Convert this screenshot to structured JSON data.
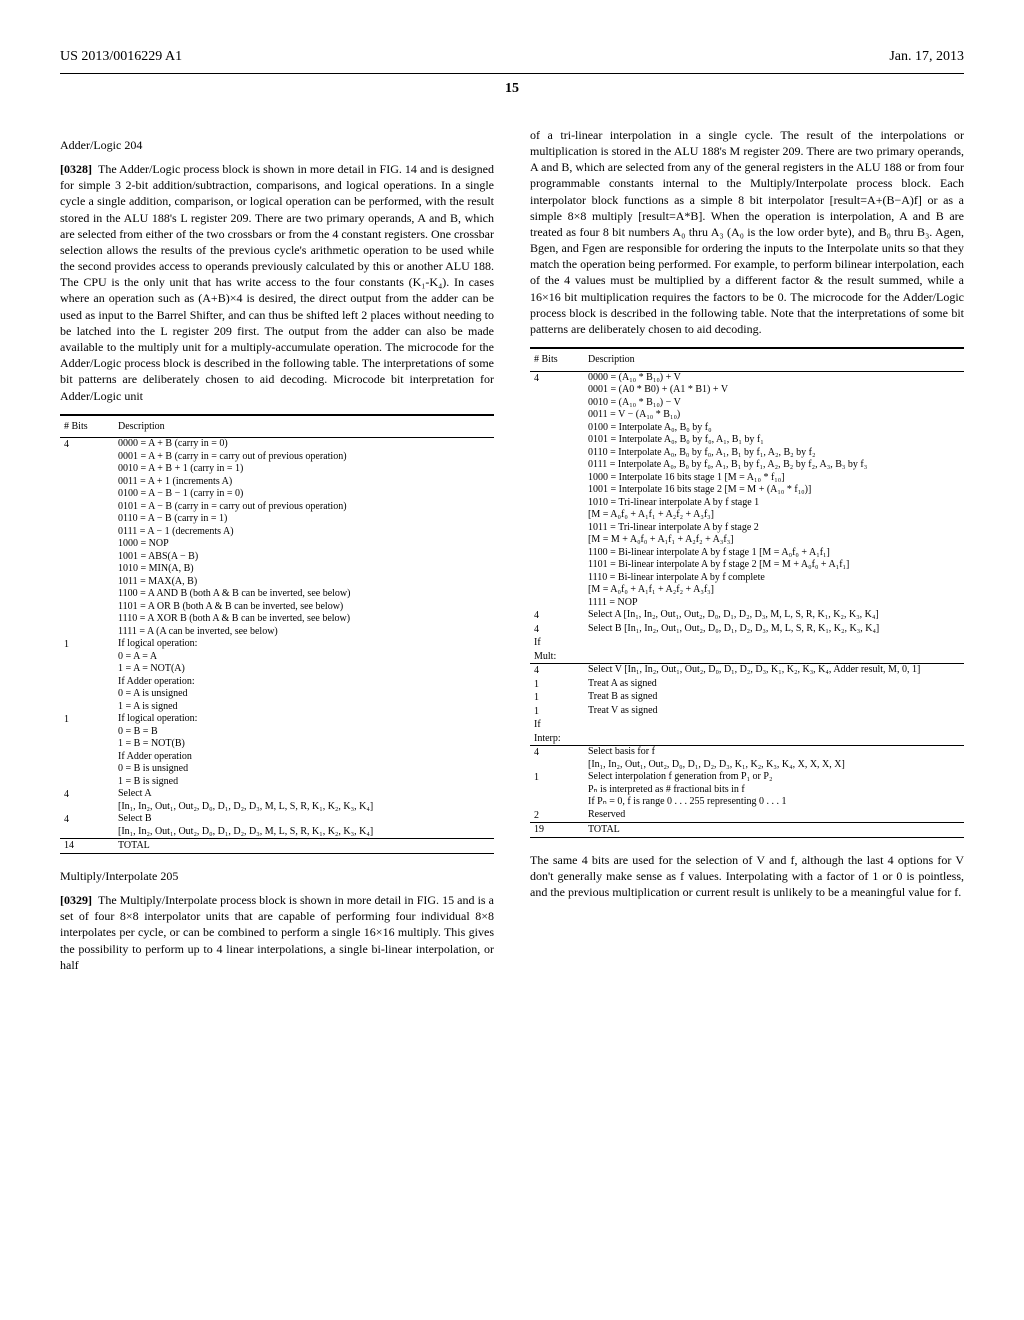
{
  "header": {
    "pub_number": "US 2013/0016229 A1",
    "pub_date": "Jan. 17, 2013",
    "page_no": "15"
  },
  "left": {
    "heading1": "Adder/Logic 204",
    "para1_num": "[0328]",
    "para1": "The Adder/Logic process block is shown in more detail in FIG. 14 and is designed for simple 3 2-bit addition/subtraction, comparisons, and logical operations. In a single cycle a single addition, comparison, or logical operation can be performed, with the result stored in the ALU 188's L register 209. There are two primary operands, A and B, which are selected from either of the two crossbars or from the 4 constant registers. One crossbar selection allows the results of the previous cycle's arithmetic operation to be used while the second provides access to operands previously calculated by this or another ALU 188. The CPU is the only unit that has write access to the four constants (K₁-K₄). In cases where an operation such as (A+B)×4 is desired, the direct output from the adder can be used as input to the Barrel Shifter, and can thus be shifted left 2 places without needing to be latched into the L register 209 first. The output from the adder can also be made available to the multiply unit for a multiply-accumulate operation. The microcode for the Adder/Logic process block is described in the following table. The interpretations of some bit patterns are deliberately chosen to aid decoding. Microcode bit interpretation for Adder/Logic unit",
    "table1": {
      "h_bits": "# Bits",
      "h_desc": "Description",
      "rows": [
        {
          "bits": "4",
          "desc": "0000 = A + B (carry in = 0)\n0001 = A + B (carry in = carry out of previous operation)\n0010 = A + B + 1 (carry in = 1)\n0011 = A + 1 (increments A)\n0100 = A − B − 1 (carry in = 0)\n0101 = A − B (carry in = carry out of previous operation)\n0110 = A − B (carry in = 1)\n0111 = A − 1 (decrements A)\n1000 = NOP\n1001 = ABS(A − B)\n1010 = MIN(A, B)\n1011 = MAX(A, B)\n1100 = A AND B (both A & B can be inverted, see below)\n1101 = A OR B (both A & B can be inverted, see below)\n1110 = A XOR B (both A & B can be inverted, see below)\n1111 = A (A can be inverted, see below)"
        },
        {
          "bits": "1",
          "desc": "If logical operation:\n0 = A = A\n1 = A = NOT(A)\nIf Adder operation:\n0 = A is unsigned\n1 = A is signed"
        },
        {
          "bits": "1",
          "desc": "If logical operation:\n0 = B = B\n1 = B = NOT(B)\nIf Adder operation\n0 = B is unsigned\n1 = B is signed"
        },
        {
          "bits": "4",
          "desc": "Select A\n[In₁, In₂, Out₁, Out₂, D₀, D₁, D₂, D₃, M, L, S, R, K₁, K₂, K₃, K₄]"
        },
        {
          "bits": "4",
          "desc": "Select B\n[In₁, In₂, Out₁, Out₂, D₀, D₁, D₂, D₃, M, L, S, R, K₁, K₂, K₃, K₄]"
        }
      ],
      "total_bits": "14",
      "total_label": "TOTAL"
    },
    "heading2": "Multiply/Interpolate 205",
    "para2_num": "[0329]",
    "para2": "The Multiply/Interpolate process block is shown in more detail in FIG. 15 and is a set of four 8×8 interpolator units that are capable of performing four individual 8×8 interpolates per cycle, or can be combined to perform a single 16×16 multiply. This gives the possibility to perform up to 4 linear interpolations, a single bi-linear interpolation, or half"
  },
  "right": {
    "para1": "of a tri-linear interpolation in a single cycle. The result of the interpolations or multiplication is stored in the ALU 188's M register 209. There are two primary operands, A and B, which are selected from any of the general registers in the ALU 188 or from four programmable constants internal to the Multiply/Interpolate process block. Each interpolator block functions as a simple 8 bit interpolator [result=A+(B−A)f] or as a simple 8×8 multiply [result=A*B]. When the operation is interpolation, A and B are treated as four 8 bit numbers A₀ thru A₃ (A₀ is the low order byte), and B₀ thru B₃. Agen, Bgen, and Fgen are responsible for ordering the inputs to the Interpolate units so that they match the operation being performed. For example, to perform bilinear interpolation, each of the 4 values must be multiplied by a different factor & the result summed, while a 16×16 bit multiplication requires the factors to be 0. The microcode for the Adder/Logic process block is described in the following table. Note that the interpretations of some bit patterns are deliberately chosen to aid decoding.",
    "table2": {
      "h_bits": "# Bits",
      "h_desc": "Description",
      "rows": [
        {
          "bits": "4",
          "desc": "0000 = (A₁₀ * B₁₀) + V\n0001 = (A0 * B0) + (A1 * B1) + V\n0010 = (A₁₀ * B₁₀) − V\n0011 = V − (A₁₀ * B₁₀)\n0100 = Interpolate A₀, B₀ by f₀\n0101 = Interpolate A₀, B₀ by f₀, A₁, B₁ by f₁\n0110 = Interpolate A₀, B₀ by f₀, A₁, B₁ by f₁, A₂, B₂ by f₂\n0111 = Interpolate A₀, B₀ by f₀, A₁, B₁ by f₁, A₂, B₂ by f₂, A₃, B₃ by f₃\n1000 = Interpolate 16 bits stage 1 [M = A₁₀ * f₁₀]\n1001 = Interpolate 16 bits stage 2 [M = M + (A₁₀ * f₁₀)]\n1010 = Tri-linear interpolate A by f stage 1\n[M = A₀f₀ + A₁f₁ + A₂f₂ + A₃f₃]\n1011 = Tri-linear interpolate A by f stage 2\n[M = M + A₀f₀ + A₁f₁ + A₂f₂ + A₃f₃]\n1100 = Bi-linear interpolate A by f stage 1 [M = A₀f₀ + A₁f₁]\n1101 = Bi-linear interpolate A by f stage 2 [M = M + A₀f₀ + A₁f₁]\n1110 = Bi-linear interpolate A by f complete\n[M = A₀f₀ + A₁f₁ + A₂f₂ + A₃f₃]\n1111 = NOP"
        },
        {
          "bits": "4",
          "desc": "Select A [In₁, In₂, Out₁, Out₂, D₀, D₁, D₂, D₃, M, L, S, R, K₁, K₂, K₃, K₄]"
        },
        {
          "bits": "4",
          "desc": "Select B [In₁, In₂, Out₁, Out₂, D₀, D₁, D₂, D₃, M, L, S, R, K₁, K₂, K₃, K₄]"
        },
        {
          "bits": "If\nMult:",
          "desc": ""
        },
        {
          "bits": "4",
          "desc": "Select V [In₁, In₂, Out₁, Out₂, D₀, D₁, D₂, D₃, K₁, K₂, K₃, K₄, Adder result, M, 0, 1]"
        },
        {
          "bits": "1",
          "desc": "Treat A as signed"
        },
        {
          "bits": "1",
          "desc": "Treat B as signed"
        },
        {
          "bits": "1",
          "desc": "Treat V as signed"
        },
        {
          "bits": "If\nInterp:",
          "desc": ""
        },
        {
          "bits": "4",
          "desc": "Select basis for f\n[In₁, In₂, Out₁, Out₂, D₀, D₁, D₂, D₃, K₁, K₂, K₃, K₄, X, X, X, X]"
        },
        {
          "bits": "1",
          "desc": "Select interpolation f generation from P₁ or P₂\nPₙ is interpreted as # fractional bits in f\nIf Pₙ = 0, f is range 0 . . . 255 representing 0 . . . 1"
        },
        {
          "bits": "2",
          "desc": "Reserved"
        }
      ],
      "total_bits": "19",
      "total_label": "TOTAL"
    },
    "para2": "The same 4 bits are used for the selection of V and f, although the last 4 options for V don't generally make sense as f values. Interpolating with a factor of 1 or 0 is pointless, and the previous multiplication or current result is unlikely to be a meaningful value for f."
  }
}
